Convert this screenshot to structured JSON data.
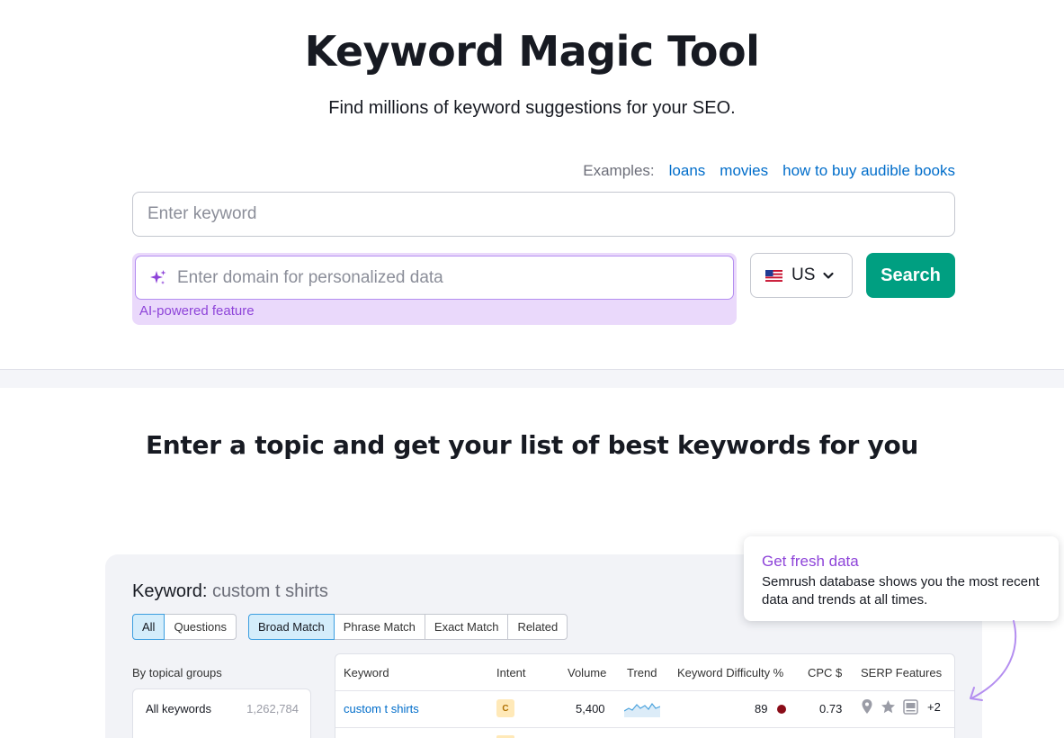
{
  "hero": {
    "title": "Keyword Magic Tool",
    "subtitle": "Find millions of keyword suggestions for your SEO.",
    "examples_label": "Examples:",
    "examples": [
      "loans",
      "movies",
      "how to buy audible books"
    ],
    "keyword_placeholder": "Enter keyword",
    "domain_placeholder": "Enter domain for personalized data",
    "ai_label": "AI-powered feature",
    "database": "US",
    "search_label": "Search"
  },
  "section": {
    "title": "Enter a topic and get your list of best keywords for you"
  },
  "preview": {
    "keyword_label": "Keyword:",
    "keyword_value": "custom t shirts",
    "tabs_left": [
      "All",
      "Questions"
    ],
    "tabs_right": [
      "Broad Match",
      "Phrase Match",
      "Exact Match",
      "Related"
    ],
    "groups_label": "By topical groups",
    "groups": [
      {
        "name": "All keywords",
        "count": "1,262,784"
      }
    ],
    "columns": [
      "Keyword",
      "Intent",
      "Volume",
      "Trend",
      "Keyword Difficulty %",
      "CPC $",
      "SERP Features"
    ],
    "rows": [
      {
        "keyword": "custom t shirts",
        "intent": "C",
        "volume": "5,400",
        "kd": "89",
        "cpc": "0.73",
        "serp_more": "+2"
      }
    ]
  },
  "tooltip": {
    "title": "Get fresh data",
    "text": "Semrush database shows you the most recent data and trends at all times."
  },
  "colors": {
    "accent_green": "#009f81",
    "link_blue": "#006dca",
    "ai_purple": "#8e44d9",
    "kd_dot": "#8a0c18"
  },
  "icons": [
    "sparkle-icon",
    "us-flag-icon",
    "chevron-down-icon",
    "location-pin-icon",
    "star-icon",
    "ad-icon",
    "curved-arrow-icon",
    "trend-sparkline-icon"
  ]
}
